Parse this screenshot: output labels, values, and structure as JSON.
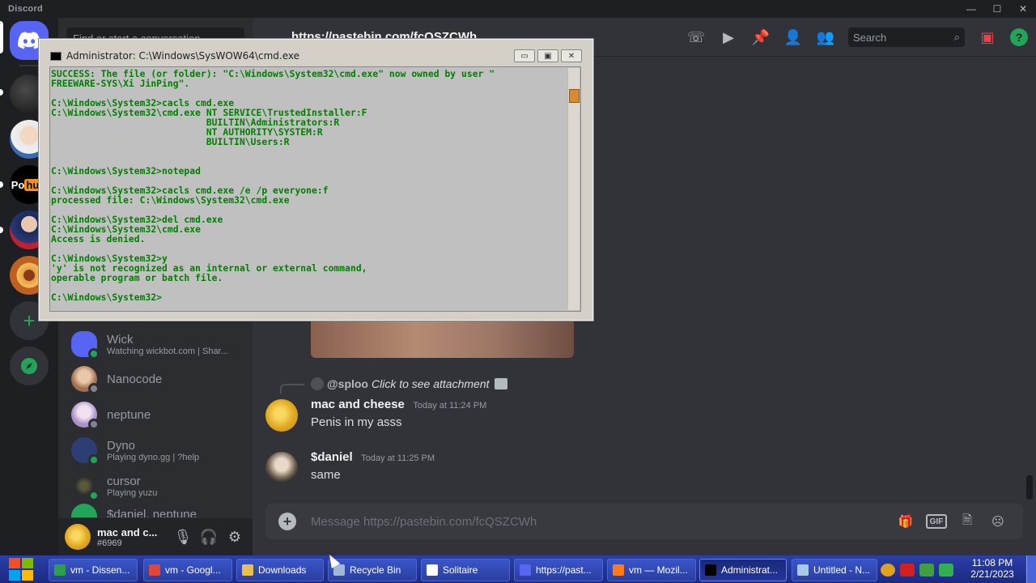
{
  "window": {
    "app_name": "Discord",
    "controls": [
      "—",
      "☐",
      "✕"
    ]
  },
  "sidebar": {
    "search_placeholder": "Find or start a conversation",
    "dms": [
      {
        "name": "Wick",
        "sub": "Watching wickbot.com | Shar...",
        "status": "online",
        "color": "#5865f2"
      },
      {
        "name": "Nanocode",
        "sub": "",
        "status": "offline",
        "color": "#c0a080"
      },
      {
        "name": "neptune",
        "sub": "",
        "status": "offline",
        "color": "#c8b0d8"
      },
      {
        "name": "Dyno",
        "sub": "Playing dyno.gg | ?help",
        "status": "online",
        "color": "#2d3e74"
      },
      {
        "name": "cursor",
        "sub": "Playing yuzu",
        "status": "online",
        "color": "#3a3a3a"
      },
      {
        "name": "$daniel, neptune",
        "sub": "",
        "status": "online",
        "color": "#23a559"
      }
    ]
  },
  "user_panel": {
    "name": "mac and c...",
    "tag": "#6969",
    "avatar_color": "#e8b830"
  },
  "header": {
    "channel": "https://pastebin.com/fcQSZCWh",
    "search_label": "Search",
    "help_label": "?"
  },
  "messages": {
    "reply": {
      "author": "@sploo",
      "text": "Click to see attachment"
    },
    "items": [
      {
        "author": "mac and cheese",
        "time": "Today at 11:24 PM",
        "text": "Penis in my asss",
        "avatar_color": "#e8b830"
      },
      {
        "author": "$daniel",
        "time": "Today at 11:25 PM",
        "text": "same",
        "avatar_color": "#5a4a40"
      }
    ]
  },
  "composer": {
    "placeholder": "Message https://pastebin.com/fcQSZCWh",
    "gif_label": "GIF"
  },
  "cmd": {
    "title": "Administrator: C:\\Windows\\SysWOW64\\cmd.exe",
    "buttons": [
      "▭",
      "▣",
      "✕"
    ],
    "lines": [
      "SUCCESS: The file (or folder): \"C:\\Windows\\System32\\cmd.exe\" now owned by user \"",
      "FREEWARE-SYS\\Xi JinPing\".",
      "",
      "C:\\Windows\\System32>cacls cmd.exe",
      "C:\\Windows\\System32\\cmd.exe NT SERVICE\\TrustedInstaller:F",
      "                            BUILTIN\\Administrators:R",
      "                            NT AUTHORITY\\SYSTEM:R",
      "                            BUILTIN\\Users:R",
      "",
      "",
      "C:\\Windows\\System32>notepad",
      "",
      "C:\\Windows\\System32>cacls cmd.exe /e /p everyone:f",
      "processed file: C:\\Windows\\System32\\cmd.exe",
      "",
      "C:\\Windows\\System32>del cmd.exe",
      "C:\\Windows\\System32\\cmd.exe",
      "Access is denied.",
      "",
      "C:\\Windows\\System32>y",
      "'y' is not recognized as an internal or external command,",
      "operable program or batch file.",
      "",
      "C:\\Windows\\System32>"
    ]
  },
  "taskbar": {
    "items": [
      {
        "label": "vm - Dissen...",
        "icon_color": "#2e9e4a",
        "active": false
      },
      {
        "label": "vm - Googl...",
        "icon_color": "#e0463a",
        "active": false
      },
      {
        "label": "Downloads",
        "icon_color": "#e8c050",
        "active": false
      },
      {
        "label": "Recycle Bin",
        "icon_color": "#a0b8d8",
        "active": false
      },
      {
        "label": "Solitaire",
        "icon_color": "#ffffff",
        "active": false
      },
      {
        "label": "https://past...",
        "icon_color": "#5865f2",
        "active": false
      },
      {
        "label": "vm — Mozil...",
        "icon_color": "#ff7a1a",
        "active": false
      },
      {
        "label": "Administrat...",
        "icon_color": "#000000",
        "active": true
      },
      {
        "label": "Untitled - N...",
        "icon_color": "#a8c8e8",
        "active": false
      }
    ],
    "time": "11:08 PM",
    "date": "2/21/2023"
  }
}
